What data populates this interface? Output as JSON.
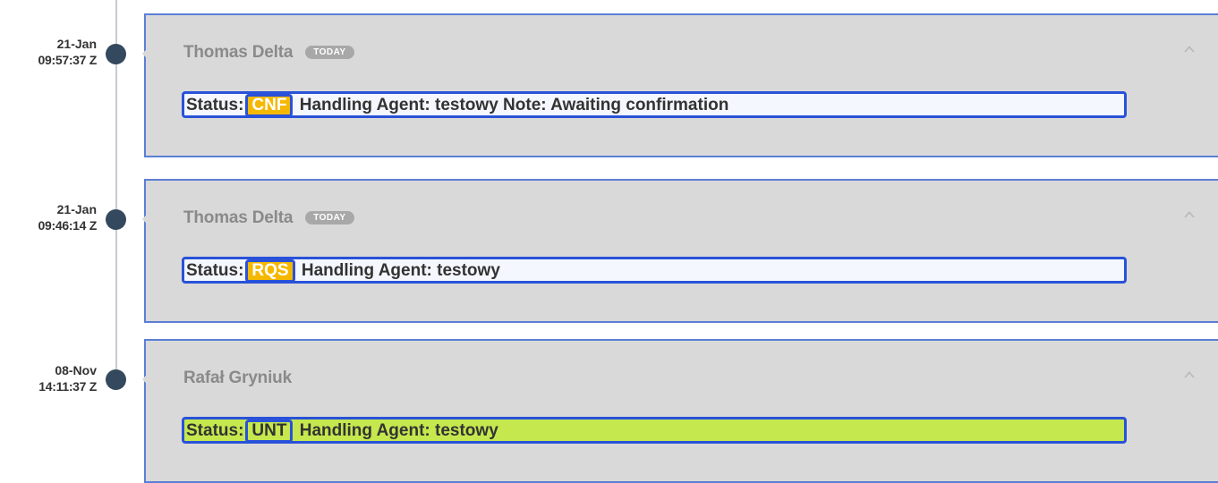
{
  "timeline": [
    {
      "date": "21-Jan",
      "time": "09:57:37 Z",
      "author": "Thomas Delta",
      "badge": "TODAY",
      "status_label": "Status:",
      "status_code": "CNF",
      "rest": "Handling Agent: testowy Note: Awaiting confirmation"
    },
    {
      "date": "21-Jan",
      "time": "09:46:14 Z",
      "author": "Thomas Delta",
      "badge": "TODAY",
      "status_label": "Status:",
      "status_code": "RQS",
      "rest": "Handling Agent: testowy"
    },
    {
      "date": "08-Nov",
      "time": "14:11:37 Z",
      "author": "Rafał Gryniuk",
      "badge": "",
      "status_label": "Status:",
      "status_code": "UNT",
      "rest": "Handling Agent: testowy"
    }
  ],
  "colors": {
    "card_bg": "#d9d9d9",
    "card_border": "#5b7fd6",
    "highlight_border": "#2952d9",
    "status_yellow": "#f5b800",
    "status_green": "#c5e84e",
    "dot": "#34495e"
  },
  "icons": {
    "collapse": "chevron-up-icon"
  }
}
